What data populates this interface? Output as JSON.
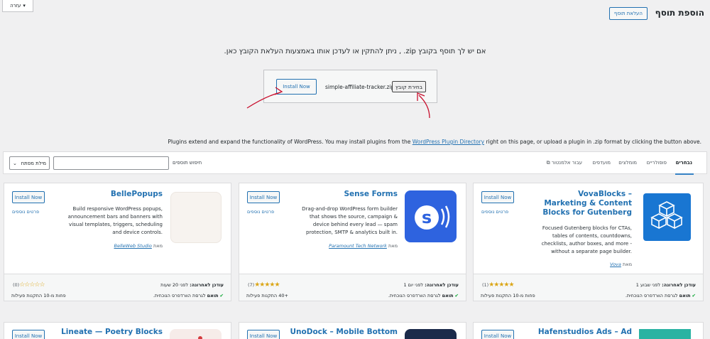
{
  "help": {
    "label": "עזרה"
  },
  "header": {
    "title": "הוספת תוסף",
    "upload_label": "העלאת תוסף"
  },
  "upload": {
    "description": "אם יש לך תוסף בקובץ zip. , ניתן להתקין או לעדכן אותו באמצעות העלאת הקובץ כאן.",
    "install_label": "Install Now",
    "file_name": "simple-affiliate-tracker.zip",
    "choose_label": "בחירת קובץ"
  },
  "intro": {
    "before": "Plugins extend and expand the functionality of WordPress. You may install plugins from the ",
    "link": "WordPress Plugin Directory",
    "after": " right on this page, or upload a plugin in .zip format by clicking the button above."
  },
  "filters": {
    "tabs": [
      "נבחרים",
      "פופולריים",
      "מומלצים",
      "מועדפים",
      "עבור אלמנטור"
    ],
    "search_label": "חיפוש תוספים",
    "keyword_label": "מילת מפתח"
  },
  "cards": [
    {
      "title": "VovaBlocks – Marketing & Content Blocks for Gutenberg",
      "description": "Focused Gutenberg blocks for CTAs, tables of contents, countdowns, checklists, author boxes, and more - without a separate page builder.",
      "by": "מאת",
      "author": "Vova",
      "install": "Install Now",
      "more": "פרטים נוספים",
      "rating": 5,
      "rating_count": "(1)",
      "updated_label": "עודכן לאחרונה:",
      "updated": "לפני שבוע 1",
      "installs": "פחות מ-10 התקנות פעילות",
      "compat_bold": "תואם",
      "compat": "לגרסת הוורדפרס הנוכחית."
    },
    {
      "title": "Sense Forms",
      "description": "Drag-and-drop WordPress form builder that shows the source, campaign & device behind every lead — spam protection, SMTP & analytics built in.",
      "by": "מאת",
      "author": "Paramount Tech Network",
      "install": "Install Now",
      "more": "פרטים נוספים",
      "rating": 5,
      "rating_count": "(7)",
      "updated_label": "עודכן לאחרונה:",
      "updated": "לפני יום 1",
      "installs": "+40 התקנות פעילות",
      "compat_bold": "תואם",
      "compat": "לגרסת הוורדפרס הנוכחית."
    },
    {
      "title": "BellePopups",
      "description": "Build responsive WordPress popups, announcement bars and banners with visual templates, triggers, scheduling and device controls.",
      "by": "מאת",
      "author": "BelleWeb Studio",
      "install": "Install Now",
      "more": "פרטים נוספים",
      "rating": 0,
      "rating_count": "(0)",
      "updated_label": "עודכן לאחרונה:",
      "updated": "לפני 20 שעות",
      "installs": "פחות מ-10 התקנות פעילות",
      "compat_bold": "תואם",
      "compat": "לגרסת הוורדפרס הנוכחית."
    },
    {
      "title": "Hafenstudios Ads – Ad",
      "install": "Install Now"
    },
    {
      "title": "UnoDock – Mobile Bottom",
      "install": "Install Now"
    },
    {
      "title": "Lineate — Poetry Blocks",
      "install": "Install Now"
    }
  ]
}
